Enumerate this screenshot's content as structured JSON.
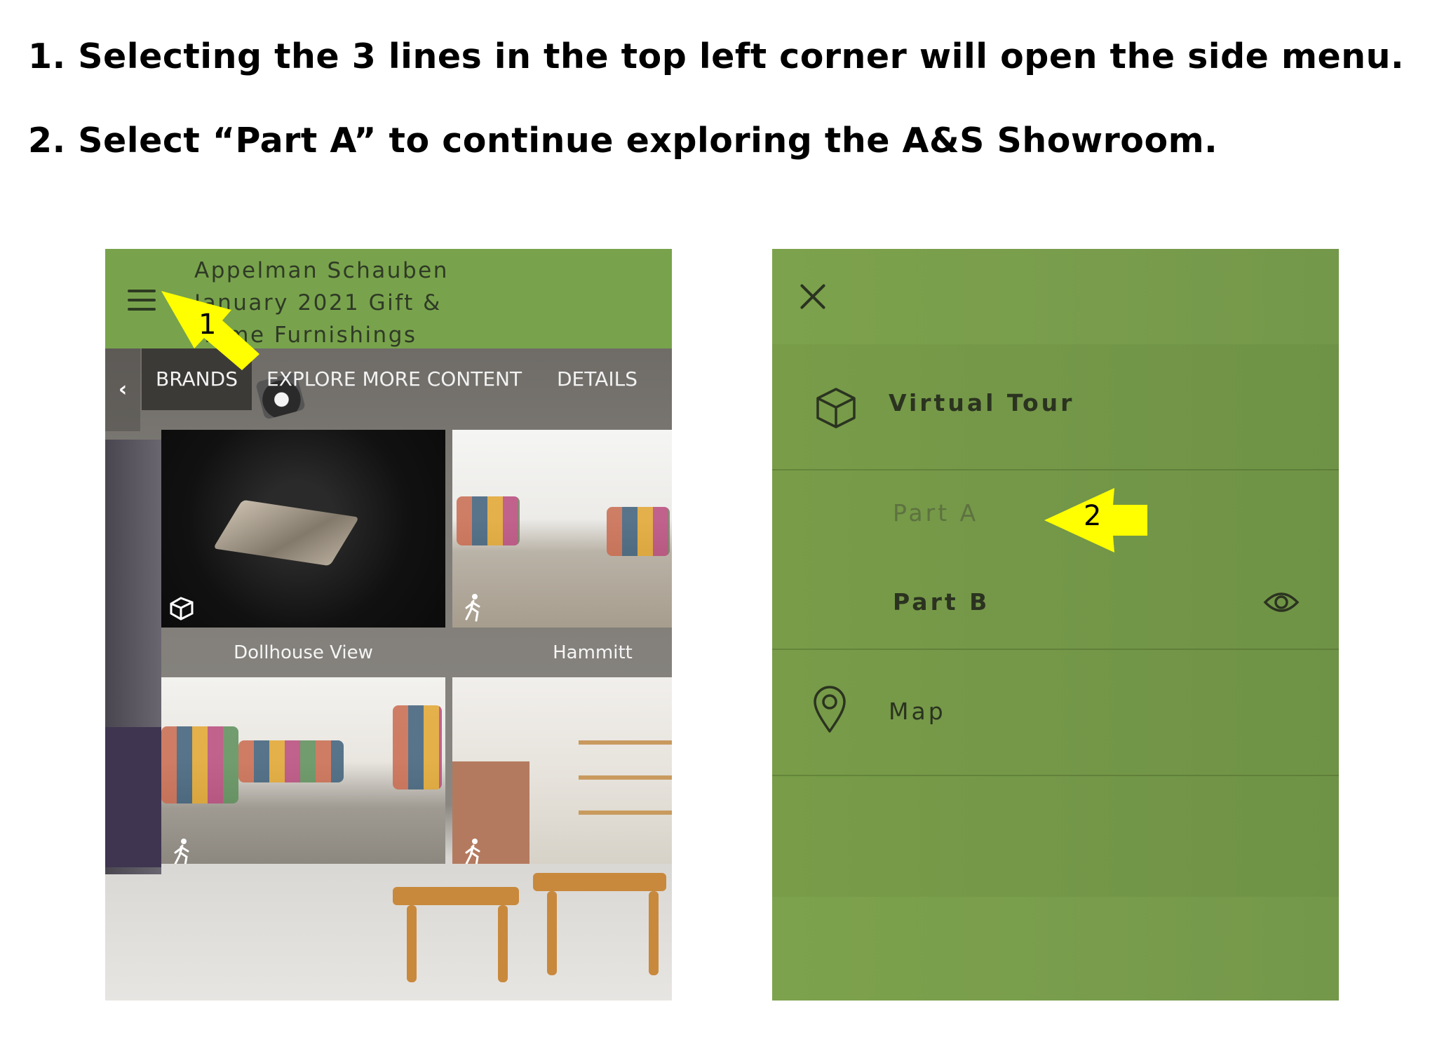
{
  "instructions": [
    "1. Selecting the 3 lines in the top left corner will open the side menu.",
    "2. Select “Part A” to continue exploring the A&S Showroom."
  ],
  "left_screen": {
    "title_lines": [
      "Appelman Schauben",
      "January 2021 Gift &",
      "Home Furnishings"
    ],
    "tabs": [
      "BRANDS",
      "EXPLORE MORE CONTENT",
      "DETAILS"
    ],
    "back_glyph": "‹",
    "thumbnails": [
      {
        "label": "Dollhouse View",
        "icon": "dollhouse-icon"
      },
      {
        "label": "Hammitt",
        "icon": "walk-icon"
      },
      {
        "label": "",
        "icon": "walk-icon"
      },
      {
        "label": "",
        "icon": "walk-icon"
      }
    ],
    "colors": {
      "header": "#78a34c",
      "tab_active": "#3c3a37"
    }
  },
  "annotations": {
    "arrow1_label": "1",
    "arrow2_label": "2",
    "arrow_color": "#ffff00"
  },
  "right_screen": {
    "menu": {
      "virtual_tour": "Virtual Tour",
      "part_a": "Part A",
      "part_b": "Part B",
      "map": "Map"
    },
    "icons": [
      "close-icon",
      "cube-icon",
      "eye-icon",
      "map-pin-icon"
    ],
    "colors": {
      "background": "#78a04b",
      "text": "#2b3320",
      "muted": "#5d7240"
    }
  }
}
